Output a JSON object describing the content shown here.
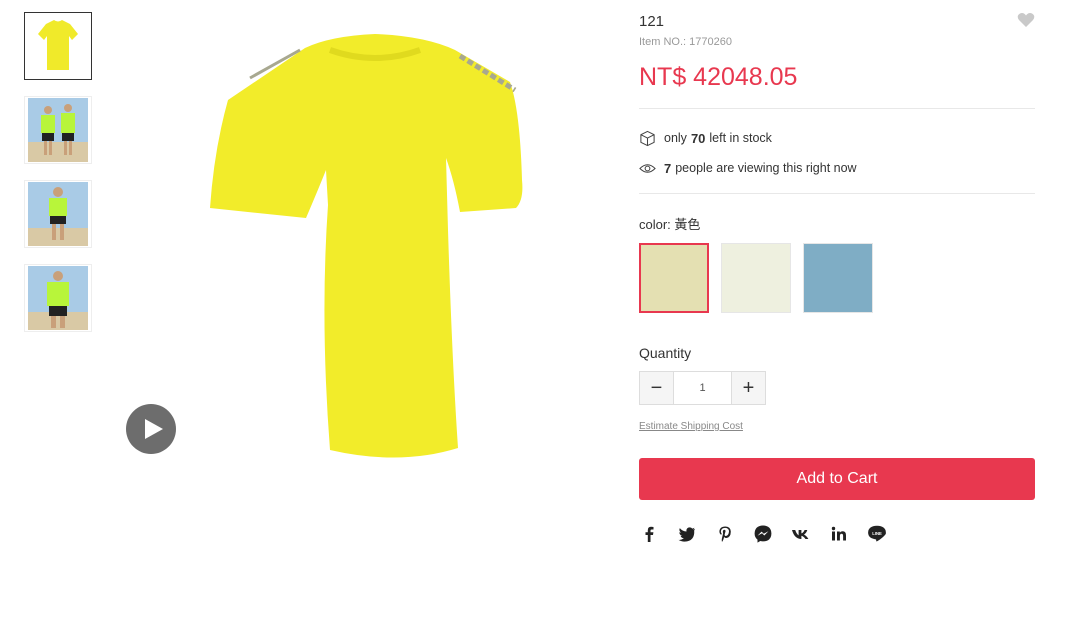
{
  "product": {
    "title": "121",
    "item_no_label": "Item NO.:",
    "item_no": "1770260",
    "price": "NT$ 42048.05"
  },
  "stock": {
    "prefix": "only",
    "count": "70",
    "suffix": "left in stock"
  },
  "viewers": {
    "count": "7",
    "suffix": "people are viewing this right now"
  },
  "color": {
    "label": "color: 黃色",
    "swatches": [
      {
        "hex": "#e4e0b2",
        "selected": true
      },
      {
        "hex": "#eef0df",
        "selected": false
      },
      {
        "hex": "#7fadc5",
        "selected": false
      }
    ]
  },
  "quantity": {
    "label": "Quantity",
    "value": "1",
    "minus": "−",
    "plus": "+"
  },
  "shipping_link": "Estimate Shipping Cost",
  "add_to_cart": "Add to Cart",
  "share_icons": [
    "facebook-icon",
    "twitter-icon",
    "pinterest-icon",
    "messenger-icon",
    "vk-icon",
    "linkedin-icon",
    "line-icon"
  ],
  "colors": {
    "accent": "#e8384f",
    "shirt": "#f2ec2a"
  }
}
